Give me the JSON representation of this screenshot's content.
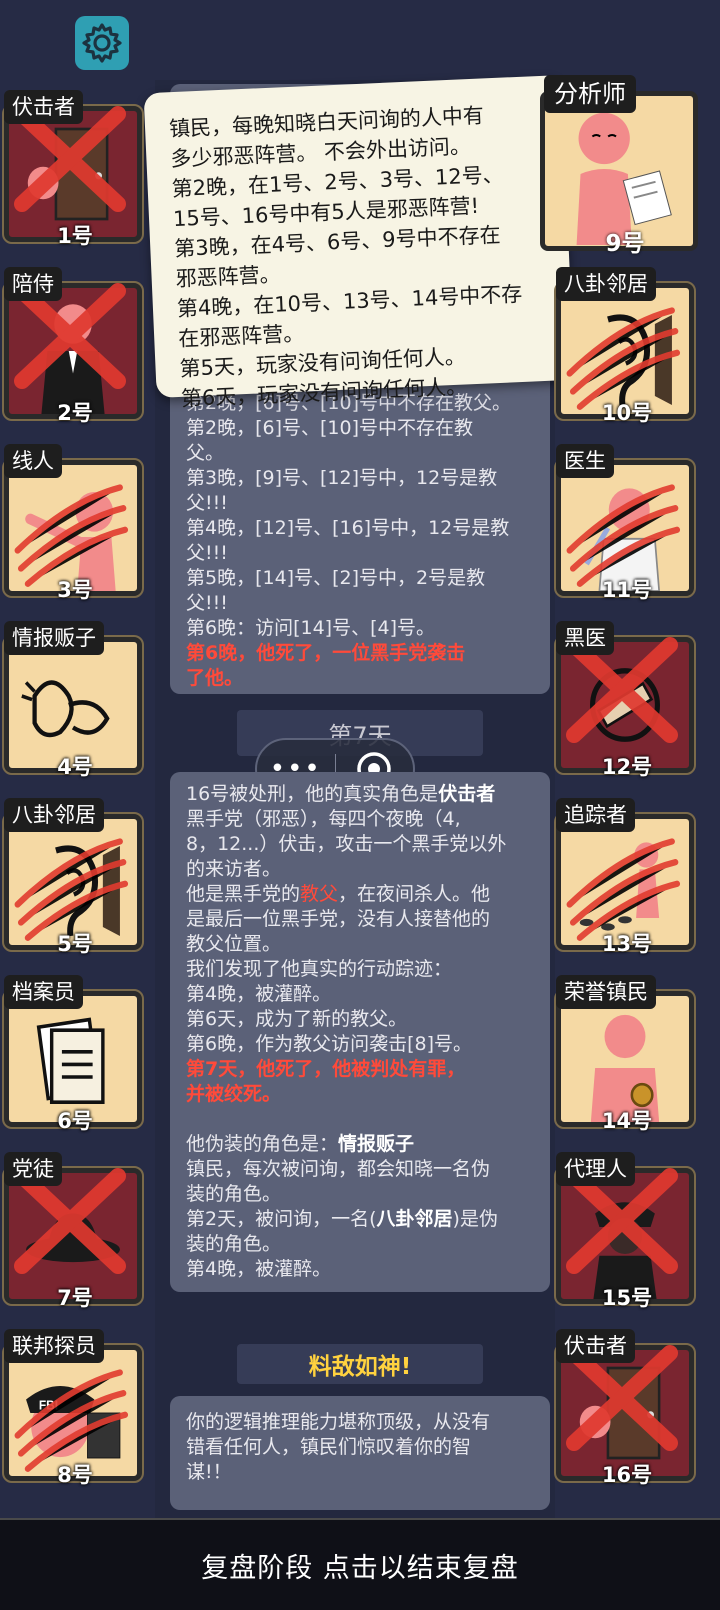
{
  "settings": {
    "icon": "gear-icon"
  },
  "tooltip": {
    "lines": [
      "镇民，每晚知晓白天问询的人中有",
      "多少邪恶阵营。 不会外出访问。",
      "第2晚，在1号、2号、3号、12号、",
      "15号、16号中有5人是邪恶阵营!",
      "第3晚，在4号、6号、9号中不存在",
      "邪恶阵营。",
      "第4晚，在10号、13号、14号中不存",
      "在邪恶阵营。",
      "第5天，玩家没有问询任何人。",
      "第6天，玩家没有问询任何人。"
    ]
  },
  "log_top": {
    "lines": [
      "第2晚，[6]号、[10]号中不存在教父。",
      "第2晚，[6]号、[10]号中不存在教",
      "父。",
      "第3晚，[9]号、[12]号中，12号是教",
      "父!!!",
      "第4晚，[12]号、[16]号中，12号是教",
      "父!!!",
      "第5晚，[14]号、[2]号中，2号是教",
      "父!!!",
      "第6晚：访问[14]号、[4]号。"
    ],
    "death": [
      "第6晚，他死了，一位黑手党袭击",
      "了他。"
    ]
  },
  "day_header": "第7天",
  "log_main": {
    "p1_a": "16号被处刑，他的真实角色是",
    "p1_role": "伏击者",
    "p1_lines": [
      "黑手党（邪恶），每四个夜晚（4,",
      "8，12...）伏击，攻击一个黑手党以外",
      "的来访者。"
    ],
    "p2_a": "他是黑手党的",
    "p2_role": "教父",
    "p2_b": "，在夜间杀人。他",
    "p2_lines": [
      "是最后一位黑手党，没有人接替他的",
      "教父位置。",
      "我们发现了他真实的行动踪迹：",
      "第4晚，被灌醉。",
      "第6天，成为了新的教父。",
      "第6晚，作为教父访问袭击[8]号。"
    ],
    "death": [
      "第7天，他死了，他被判处有罪，",
      "并被绞死。"
    ],
    "p3_a": "他伪装的角色是：",
    "p3_role": "情报贩子",
    "p3_lines": [
      "镇民，每次被问询，都会知晓一名伪",
      "装的角色。"
    ],
    "p3_c": "第2天，被问询，一名(",
    "p3_role2": "八卦邻居",
    "p3_d": ")是伪",
    "p3_lines2": [
      "装的角色。",
      "第4晚，被灌醉。"
    ]
  },
  "result_header": "料敌如神!",
  "result_text": [
    "你的逻辑推理能力堪称顶级，从没有",
    "错看任何人，镇民们惊叹着你的智",
    "谋!！"
  ],
  "capsule": {
    "more": "•••",
    "close_icon": "target-close-icon"
  },
  "left_cards": [
    {
      "role": "伏击者",
      "num": "1号",
      "dead": true,
      "art": "door-icon"
    },
    {
      "role": "陪侍",
      "num": "2号",
      "dead": true,
      "art": "suit-figure-icon"
    },
    {
      "role": "线人",
      "num": "3号",
      "dead": false,
      "art": "pointing-figure-icon"
    },
    {
      "role": "情报贩子",
      "num": "4号",
      "dead": false,
      "art": "whisper-icon"
    },
    {
      "role": "八卦邻居",
      "num": "5号",
      "dead": false,
      "art": "ear-icon"
    },
    {
      "role": "档案员",
      "num": "6号",
      "dead": false,
      "art": "documents-icon"
    },
    {
      "role": "党徒",
      "num": "7号",
      "dead": true,
      "art": "hat-icon"
    },
    {
      "role": "联邦探员",
      "num": "8号",
      "dead": false,
      "art": "fbi-badge-icon"
    }
  ],
  "right_cards": [
    {
      "role": "分析师",
      "num": "9号",
      "dead": false,
      "art": "thinking-figure-icon"
    },
    {
      "role": "八卦邻居",
      "num": "10号",
      "dead": false,
      "art": "ear-icon"
    },
    {
      "role": "医生",
      "num": "11号",
      "dead": false,
      "art": "doctor-icon"
    },
    {
      "role": "黑医",
      "num": "12号",
      "dead": true,
      "art": "bandage-icon"
    },
    {
      "role": "追踪者",
      "num": "13号",
      "dead": false,
      "art": "footprints-icon"
    },
    {
      "role": "荣誉镇民",
      "num": "14号",
      "dead": false,
      "art": "medal-figure-icon"
    },
    {
      "role": "代理人",
      "num": "15号",
      "dead": true,
      "art": "agent-icon"
    },
    {
      "role": "伏击者",
      "num": "16号",
      "dead": true,
      "art": "door-icon"
    }
  ],
  "footer": "复盘阶段 点击以结束复盘",
  "colors": {
    "background": "#262b45",
    "panel": "#5b6178",
    "accent_red": "#ff4a3a",
    "accent_yellow": "#ffd23f",
    "card_bg": "#f5d9a4",
    "dead_bg": "#7a2530"
  }
}
